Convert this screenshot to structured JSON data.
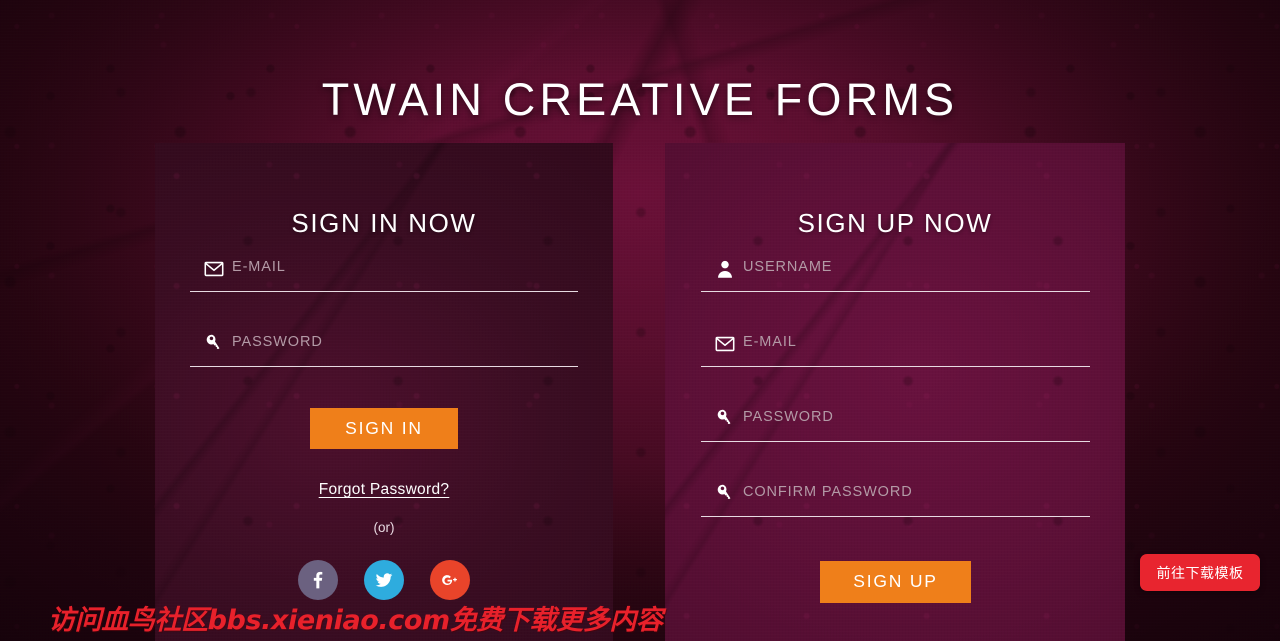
{
  "page": {
    "title": "TWAIN CREATIVE FORMS"
  },
  "signin": {
    "heading": "SIGN IN NOW",
    "fields": [
      {
        "icon": "mail-icon",
        "placeholder": "E-MAIL",
        "value": ""
      },
      {
        "icon": "key-icon",
        "placeholder": "PASSWORD",
        "value": ""
      }
    ],
    "submit_label": "SIGN IN",
    "forgot_label": "Forgot Password?",
    "or_label": "(or)",
    "social": [
      {
        "name": "facebook",
        "glyph": "f",
        "color": "#6b6180"
      },
      {
        "name": "twitter",
        "glyph": "t",
        "color": "#2eacde"
      },
      {
        "name": "google-plus",
        "glyph": "G+",
        "color": "#e9442a"
      }
    ]
  },
  "signup": {
    "heading": "SIGN UP NOW",
    "fields": [
      {
        "icon": "user-icon",
        "placeholder": "USERNAME",
        "value": ""
      },
      {
        "icon": "mail-icon",
        "placeholder": "E-MAIL",
        "value": ""
      },
      {
        "icon": "key-icon",
        "placeholder": "PASSWORD",
        "value": ""
      },
      {
        "icon": "key-icon",
        "placeholder": "CONFIRM PASSWORD",
        "value": ""
      }
    ],
    "submit_label": "SIGN UP"
  },
  "overlay": {
    "watermark": "访问血鸟社区bbs.xieniao.com免费下载更多内容",
    "download_button": "前往下载模板"
  },
  "colors": {
    "accent_orange": "#ef7f1a",
    "panel_left": "#3d0f25",
    "panel_right": "#5e1038",
    "background": "#2b0512",
    "watermark_red": "#e8212b",
    "float_button_red": "#e8252f",
    "field_line": "#e7dbe2",
    "label_text": "#b39aa6"
  }
}
